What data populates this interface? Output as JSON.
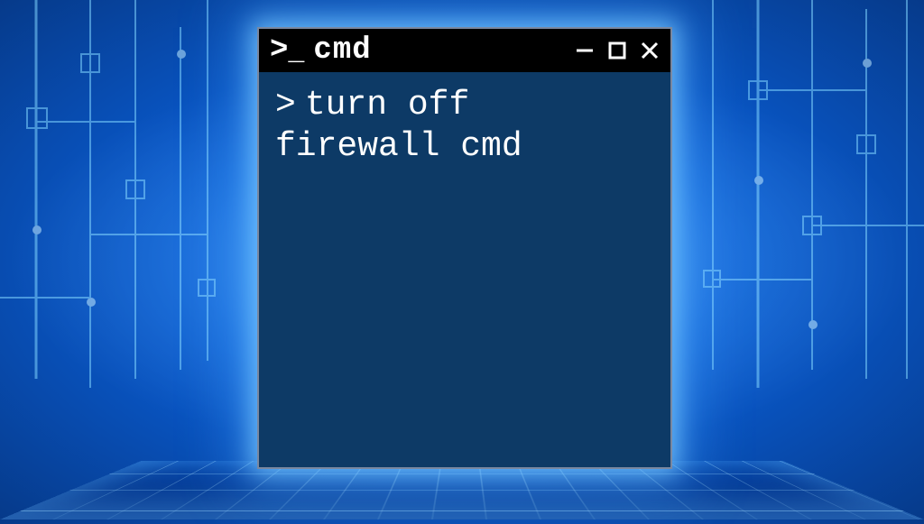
{
  "window": {
    "title": "cmd",
    "icon_name": "terminal-prompt-icon"
  },
  "terminal": {
    "prompt_char": ">",
    "command_text": "turn off firewall cmd"
  },
  "colors": {
    "terminal_bg": "#0d3a66",
    "titlebar_bg": "#000000",
    "text": "#ffffff",
    "glow": "#7fd4ff"
  }
}
